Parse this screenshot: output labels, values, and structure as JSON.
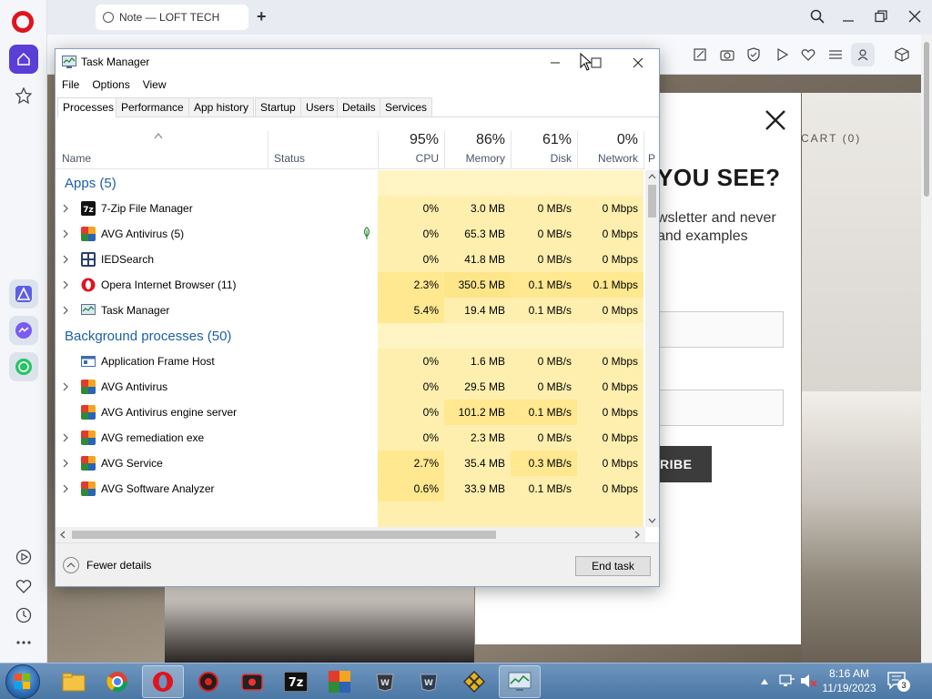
{
  "browser": {
    "tab_title": "Note — LOFT TECH",
    "popup": {
      "heading": "YOU SEE?",
      "text": "wsletter and never and examples",
      "cart": "CART (0)",
      "button": "RIBE"
    }
  },
  "taskmanager": {
    "title": "Task Manager",
    "menu": [
      "File",
      "Options",
      "View"
    ],
    "tabs": [
      "Processes",
      "Performance",
      "App history",
      "Startup",
      "Users",
      "Details",
      "Services"
    ],
    "headers": {
      "name": "Name",
      "status": "Status",
      "cpu_pct": "95%",
      "cpu": "CPU",
      "mem_pct": "86%",
      "mem": "Memory",
      "disk_pct": "61%",
      "disk": "Disk",
      "net_pct": "0%",
      "net": "Network",
      "power_partial": "P"
    },
    "groups": {
      "apps": "Apps (5)",
      "background": "Background processes (50)"
    },
    "apps": [
      {
        "name": "7-Zip File Manager",
        "cpu": "0%",
        "mem": "3.0 MB",
        "disk": "0 MB/s",
        "net": "0 Mbps"
      },
      {
        "name": "AVG Antivirus (5)",
        "cpu": "0%",
        "mem": "65.3 MB",
        "disk": "0 MB/s",
        "net": "0 Mbps"
      },
      {
        "name": "IEDSearch",
        "cpu": "0%",
        "mem": "41.8 MB",
        "disk": "0 MB/s",
        "net": "0 Mbps"
      },
      {
        "name": "Opera Internet Browser (11)",
        "cpu": "2.3%",
        "mem": "350.5 MB",
        "disk": "0.1 MB/s",
        "net": "0.1 Mbps"
      },
      {
        "name": "Task Manager",
        "cpu": "5.4%",
        "mem": "19.4 MB",
        "disk": "0.1 MB/s",
        "net": "0 Mbps"
      }
    ],
    "background": [
      {
        "name": "Application Frame Host",
        "cpu": "0%",
        "mem": "1.6 MB",
        "disk": "0 MB/s",
        "net": "0 Mbps"
      },
      {
        "name": "AVG Antivirus",
        "cpu": "0%",
        "mem": "29.5 MB",
        "disk": "0 MB/s",
        "net": "0 Mbps"
      },
      {
        "name": "AVG Antivirus engine server",
        "cpu": "0%",
        "mem": "101.2 MB",
        "disk": "0.1 MB/s",
        "net": "0 Mbps"
      },
      {
        "name": "AVG remediation exe",
        "cpu": "0%",
        "mem": "2.3 MB",
        "disk": "0 MB/s",
        "net": "0 Mbps"
      },
      {
        "name": "AVG Service",
        "cpu": "2.7%",
        "mem": "35.4 MB",
        "disk": "0.3 MB/s",
        "net": "0 Mbps"
      },
      {
        "name": "AVG Software Analyzer",
        "cpu": "0.6%",
        "mem": "33.9 MB",
        "disk": "0.1 MB/s",
        "net": "0 Mbps"
      }
    ],
    "footer": {
      "fewer": "Fewer details",
      "end_task": "End task"
    }
  },
  "taskbar": {
    "time": "8:16 AM",
    "date": "11/19/2023",
    "notifications": "3"
  }
}
